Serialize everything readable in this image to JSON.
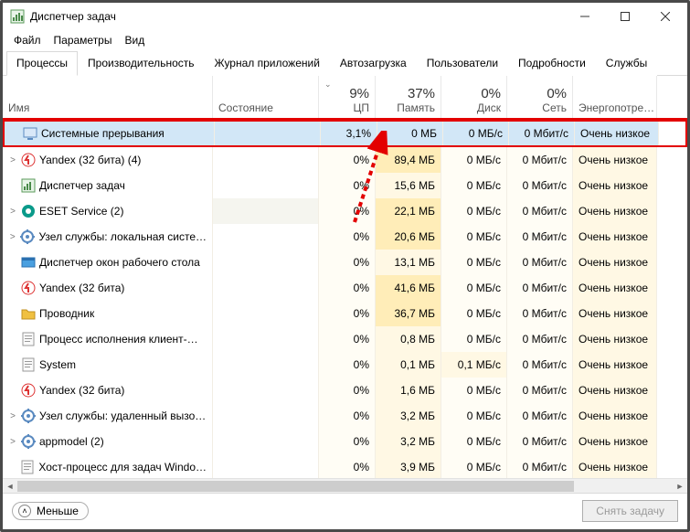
{
  "window": {
    "title": "Диспетчер задач"
  },
  "menu": {
    "file": "Файл",
    "options": "Параметры",
    "view": "Вид"
  },
  "tabs": {
    "processes": "Процессы",
    "performance": "Производительность",
    "app_history": "Журнал приложений",
    "startup": "Автозагрузка",
    "users": "Пользователи",
    "details": "Подробности",
    "services": "Службы"
  },
  "columns": {
    "name": "Имя",
    "status": "Состояние",
    "cpu": "ЦП",
    "memory": "Память",
    "disk": "Диск",
    "network": "Сеть",
    "energy": "Энергопотре…"
  },
  "totals": {
    "cpu": "9%",
    "memory": "37%",
    "disk": "0%",
    "network": "0%"
  },
  "rows": [
    {
      "exp": "",
      "icon": "sys",
      "name": "Системные прерывания",
      "cpu": "3,1%",
      "mem": "0 МБ",
      "disk": "0 МБ/с",
      "net": "0 Мбит/с",
      "energy": "Очень низкое",
      "hl": true,
      "sel": true
    },
    {
      "exp": ">",
      "icon": "yandex",
      "name": "Yandex (32 бита) (4)",
      "cpu": "0%",
      "mem": "89,4 МБ",
      "disk": "0 МБ/с",
      "net": "0 Мбит/с",
      "energy": "Очень низкое"
    },
    {
      "exp": "",
      "icon": "tm",
      "name": "Диспетчер задач",
      "cpu": "0%",
      "mem": "15,6 МБ",
      "disk": "0 МБ/с",
      "net": "0 Мбит/с",
      "energy": "Очень низкое"
    },
    {
      "exp": ">",
      "icon": "eset",
      "name": "ESET Service (2)",
      "cpu": "0%",
      "mem": "22,1 МБ",
      "disk": "0 МБ/с",
      "net": "0 Мбит/с",
      "energy": "Очень низкое",
      "altbg": true
    },
    {
      "exp": ">",
      "icon": "svc",
      "name": "Узел службы: локальная систе…",
      "cpu": "0%",
      "mem": "20,6 МБ",
      "disk": "0 МБ/с",
      "net": "0 Мбит/с",
      "energy": "Очень низкое"
    },
    {
      "exp": "",
      "icon": "dwm",
      "name": "Диспетчер окон рабочего стола",
      "cpu": "0%",
      "mem": "13,1 МБ",
      "disk": "0 МБ/с",
      "net": "0 Мбит/с",
      "energy": "Очень низкое"
    },
    {
      "exp": "",
      "icon": "yandex",
      "name": "Yandex (32 бита)",
      "cpu": "0%",
      "mem": "41,6 МБ",
      "disk": "0 МБ/с",
      "net": "0 Мбит/с",
      "energy": "Очень низкое"
    },
    {
      "exp": "",
      "icon": "explorer",
      "name": "Проводник",
      "cpu": "0%",
      "mem": "36,7 МБ",
      "disk": "0 МБ/с",
      "net": "0 Мбит/с",
      "energy": "Очень низкое"
    },
    {
      "exp": "",
      "icon": "exe",
      "name": "Процесс исполнения клиент-…",
      "cpu": "0%",
      "mem": "0,8 МБ",
      "disk": "0 МБ/с",
      "net": "0 Мбит/с",
      "energy": "Очень низкое"
    },
    {
      "exp": "",
      "icon": "exe",
      "name": "System",
      "cpu": "0%",
      "mem": "0,1 МБ",
      "disk": "0,1 МБ/с",
      "net": "0 Мбит/с",
      "energy": "Очень низкое"
    },
    {
      "exp": "",
      "icon": "yandex",
      "name": "Yandex (32 бита)",
      "cpu": "0%",
      "mem": "1,6 МБ",
      "disk": "0 МБ/с",
      "net": "0 Мбит/с",
      "energy": "Очень низкое"
    },
    {
      "exp": ">",
      "icon": "svc",
      "name": "Узел службы: удаленный вызо…",
      "cpu": "0%",
      "mem": "3,2 МБ",
      "disk": "0 МБ/с",
      "net": "0 Мбит/с",
      "energy": "Очень низкое"
    },
    {
      "exp": ">",
      "icon": "svc",
      "name": "appmodel (2)",
      "cpu": "0%",
      "mem": "3,2 МБ",
      "disk": "0 МБ/с",
      "net": "0 Мбит/с",
      "energy": "Очень низкое"
    },
    {
      "exp": "",
      "icon": "exe",
      "name": "Хост-процесс для задач Windo…",
      "cpu": "0%",
      "mem": "3,9 МБ",
      "disk": "0 МБ/с",
      "net": "0 Мбит/с",
      "energy": "Очень низкое"
    }
  ],
  "footer": {
    "less": "Меньше",
    "end_task": "Снять задачу"
  }
}
